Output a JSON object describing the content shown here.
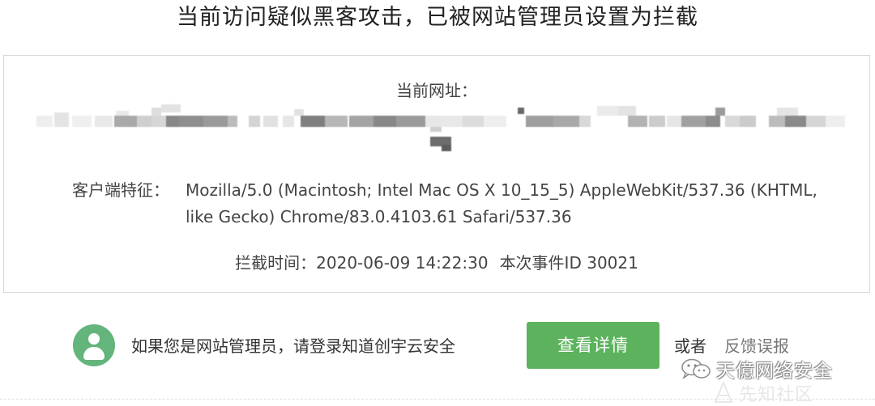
{
  "page": {
    "headline": "当前访问疑似黑客攻击，已被网站管理员设置为拦截"
  },
  "info": {
    "url_label": "当前网址：",
    "ua_label": "客户端特征：",
    "ua_value": "Mozilla/5.0 (Macintosh; Intel Mac OS X 10_15_5) AppleWebKit/537.36 (KHTML, like Gecko) Chrome/83.0.4103.61 Safari/537.36",
    "time_label": "拦截时间：",
    "time_value": "2020-06-09 14:22:30",
    "event_label": "本次事件ID",
    "event_id": "30021"
  },
  "footer": {
    "admin_text": "如果您是网站管理员，请登录知道创宇云安全",
    "details_button": "查看详情",
    "or_text": "或者",
    "feedback_link": "反馈误报"
  },
  "watermark": {
    "text": "天億网络安全",
    "secondary_text": "先知社区"
  },
  "colors": {
    "accent_green": "#5cb25d",
    "avatar_green": "#64b57b",
    "text_dark": "#333333",
    "text_muted": "#777777",
    "border": "#d9d9d9"
  },
  "icons": {
    "avatar": "user-icon",
    "watermark": "wechat-icon"
  }
}
